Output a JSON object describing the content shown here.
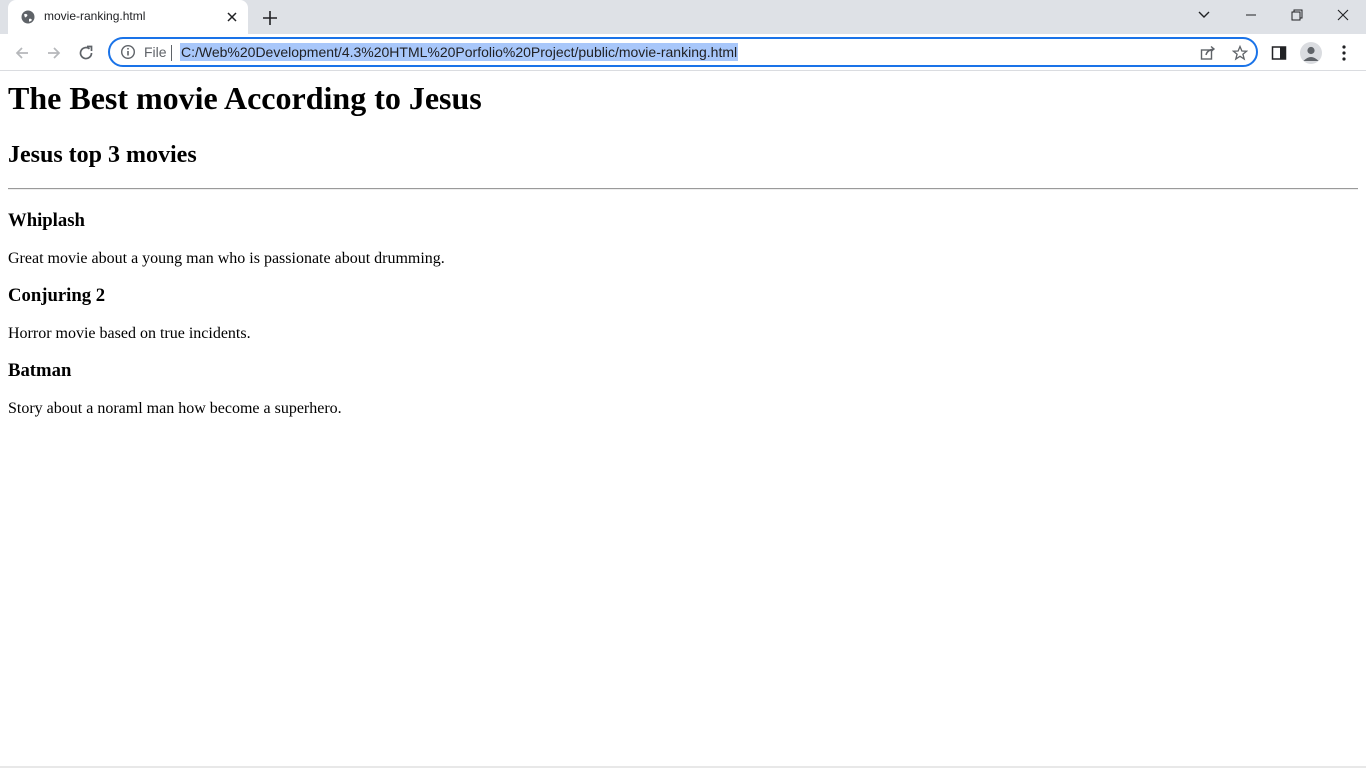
{
  "browser": {
    "tab_title": "movie-ranking.html",
    "scheme_chip": "File",
    "url": "C:/Web%20Development/4.3%20HTML%20Porfolio%20Project/public/movie-ranking.html",
    "accent_color": "#1a73e8",
    "selection_color": "#a8c7fa"
  },
  "page": {
    "title": "The Best movie According to Jesus",
    "subtitle": "Jesus top 3 movies",
    "movies": [
      {
        "name": "Whiplash",
        "description": "Great movie about a young man who is passionate about drumming."
      },
      {
        "name": "Conjuring 2",
        "description": "Horror movie based on true incidents."
      },
      {
        "name": "Batman",
        "description": "Story about a noraml man how become a superhero."
      }
    ]
  }
}
